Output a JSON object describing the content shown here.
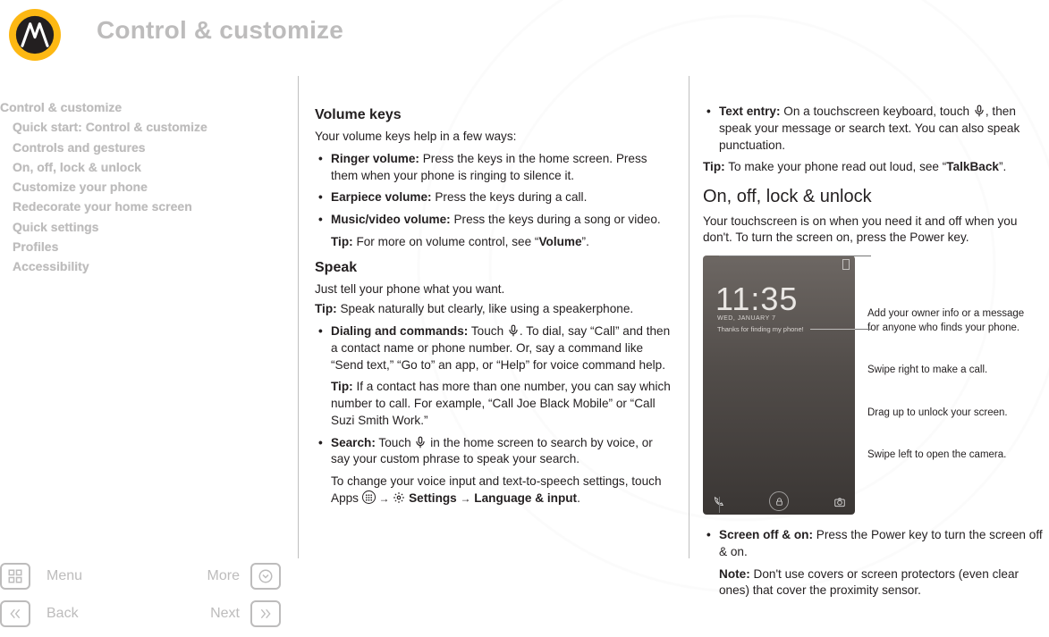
{
  "header": {
    "title": "Control & customize"
  },
  "toc": {
    "items": [
      {
        "label": "Control & customize",
        "indent": false
      },
      {
        "label": "Quick start: Control & customize",
        "indent": true
      },
      {
        "label": "Controls and gestures",
        "indent": true
      },
      {
        "label": "On, off, lock & unlock",
        "indent": true
      },
      {
        "label": "Customize your phone",
        "indent": true
      },
      {
        "label": "Redecorate your home screen",
        "indent": true
      },
      {
        "label": "Quick settings",
        "indent": true
      },
      {
        "label": "Profiles",
        "indent": true
      },
      {
        "label": "Accessibility",
        "indent": true
      }
    ]
  },
  "nav": {
    "menu": "Menu",
    "more": "More",
    "back": "Back",
    "next": "Next"
  },
  "col1": {
    "volume_h": "Volume keys",
    "volume_intro": "Your volume keys help in a few ways:",
    "ringer_b": "Ringer volume:",
    "ringer_t": " Press the keys in the home screen. Press them when your phone is ringing to silence it.",
    "ear_b": "Earpiece volume:",
    "ear_t": " Press the keys during a call.",
    "music_b": "Music/video volume:",
    "music_t": " Press the keys during a song or video.",
    "tip_vol_pre": "Tip:",
    "tip_vol_mid": " For more on volume control, see ",
    "tip_vol_link": "Volume",
    "speak_h": "Speak",
    "speak_intro": "Just tell your phone what you want.",
    "tip_speak_pre": "Tip:",
    "tip_speak_t": " Speak naturally but clearly, like using a speakerphone.",
    "dial_b": "Dialing and commands:",
    "dial_t1": " Touch ",
    "dial_t2": ". To dial, say “Call” and then a contact name or phone number. Or, say a command like “Send text,” “Go to” an app, or “Help” for voice command help.",
    "dial_tip_pre": "Tip:",
    "dial_tip_t": " If a contact has more than one number, you can say which number to call. For example, “Call Joe Black Mobile” or “Call Suzi Smith Work.”",
    "search_b": "Search:",
    "search_t1": " Touch ",
    "search_t2": " in the home screen to search by voice, or say your custom phrase to speak your search.",
    "voice_settings_1": "To change your voice input and text-to-speech settings, touch Apps ",
    "voice_settings_set": "Settings",
    "voice_settings_2": "Language & input"
  },
  "col2": {
    "text_b": "Text entry:",
    "text_t1": " On a touchscreen keyboard, touch ",
    "text_t2": ", then speak your message or search text. You can also speak punctuation.",
    "tip_read_pre": "Tip:",
    "tip_read_mid": " To make your phone read out loud, see ",
    "tip_read_link": "TalkBack",
    "onoff_h": "On, off, lock & unlock",
    "onoff_intro": "Your touchscreen is on when you need it and off when you don't. To turn the screen on, press the Power key.",
    "lock_time": "11:35",
    "lock_date": "WED, JANUARY 7",
    "lock_msg": "Thanks for finding my phone!",
    "annot_owner": "Add your owner info or a message for anyone who finds your phone.",
    "annot_call": "Swipe right to make a call.",
    "annot_unlock": "Drag up to unlock your screen.",
    "annot_camera": "Swipe left to open the camera.",
    "screen_b": "Screen off & on:",
    "screen_t": " Press the Power key to turn the screen off & on.",
    "note_pre": "Note:",
    "note_t": " Don't use covers or screen protectors (even clear ones) that cover the proximity sensor."
  }
}
